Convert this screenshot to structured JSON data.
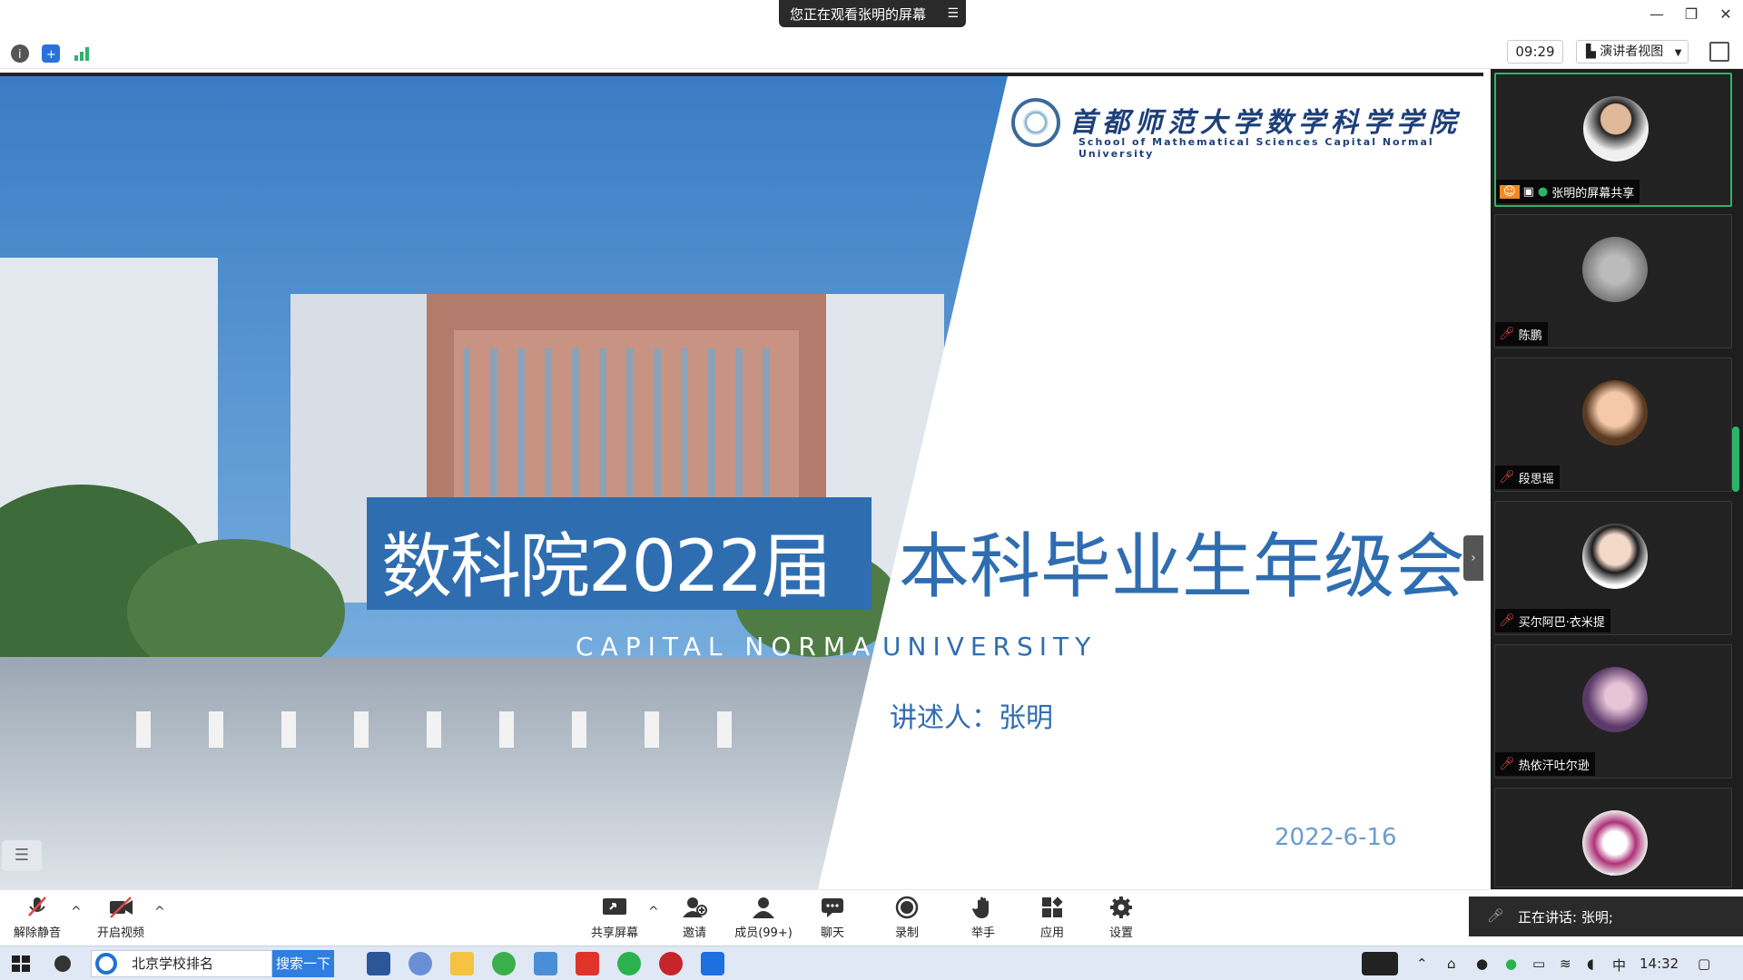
{
  "window": {
    "viewing_banner": "您正在观看张明的屏幕",
    "minimize_glyph": "—",
    "restore_glyph": "❐",
    "close_glyph": "✕"
  },
  "top_toolbar": {
    "meeting_time": "09:29",
    "view_mode": "演讲者视图",
    "icons": [
      "info-icon",
      "shield-icon",
      "signal-icon",
      "fullscreen-icon"
    ]
  },
  "slide": {
    "school_cn": "首都师范大学数学科学学院",
    "school_en": "School of Mathematical Sciences Capital Normal University",
    "title_left": "数科院2022届",
    "title_right": "本科毕业生年级会",
    "subtitle_left": "CAPITAL NORMAL",
    "subtitle_right": "UNIVERSITY",
    "speaker": "讲述人：张明",
    "date": "2022-6-16"
  },
  "participants": [
    {
      "name": "张明的屏幕共享",
      "muted": false,
      "active": true
    },
    {
      "name": "陈鹏",
      "muted": true,
      "active": false
    },
    {
      "name": "段思瑶",
      "muted": true,
      "active": false
    },
    {
      "name": "买尔阿巴·衣米提",
      "muted": true,
      "active": false
    },
    {
      "name": "热依汗吐尔逊",
      "muted": true,
      "active": false
    },
    {
      "name": "",
      "muted": true,
      "active": false
    }
  ],
  "controls": {
    "unmute": "解除静音",
    "start_video": "开启视频",
    "share_screen": "共享屏幕",
    "invite": "邀请",
    "members": "成员(99+)",
    "chat": "聊天",
    "record": "录制",
    "raise_hand": "举手",
    "apps": "应用",
    "settings": "设置"
  },
  "speaking_indicator": "正在讲话: 张明;",
  "taskbar": {
    "browser_tab": "北京学校排名",
    "search_button": "搜索一下",
    "ime": "中",
    "clock": "14:32"
  },
  "colors": {
    "brand_blue": "#2f6db1",
    "active_green": "#2db36a",
    "mic_off_red": "#e04848"
  }
}
